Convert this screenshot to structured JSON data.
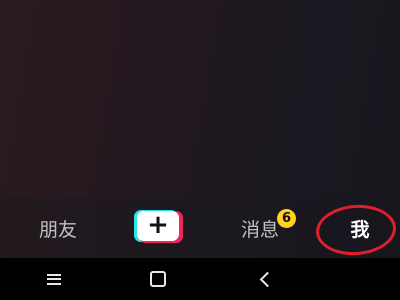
{
  "tabbar": {
    "friends_label": "朋友",
    "add_label": "+",
    "messages_label": "消息",
    "messages_badge": "6",
    "me_label": "我"
  },
  "colors": {
    "badge": "#ffd21f",
    "annotation_circle": "#e01e2e",
    "add_button_cyan": "#28e6ee",
    "add_button_red": "#f0285a"
  },
  "navbar": {
    "icons": [
      "menu-icon",
      "home-icon",
      "back-icon"
    ]
  }
}
